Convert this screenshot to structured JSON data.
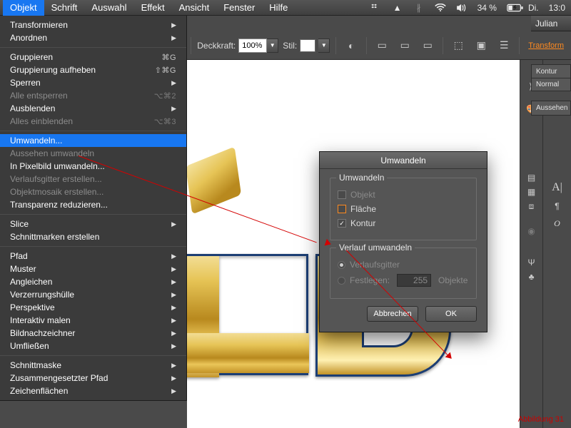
{
  "menubar": {
    "items": [
      "Objekt",
      "Schrift",
      "Auswahl",
      "Effekt",
      "Ansicht",
      "Fenster",
      "Hilfe"
    ],
    "active": 0
  },
  "status": {
    "battery": "34 %",
    "charging_icon": "⚡",
    "day": "Di.",
    "time": "13:0"
  },
  "title_right": "Julian",
  "optionsbar": {
    "opacity_label": "Deckkraft:",
    "opacity_value": "100%",
    "style_label": "Stil:",
    "transform_link": "Transform"
  },
  "dropdown": {
    "groups": [
      [
        {
          "label": "Transformieren",
          "enabled": true,
          "sub": true
        },
        {
          "label": "Anordnen",
          "enabled": true,
          "sub": true
        }
      ],
      [
        {
          "label": "Gruppieren",
          "enabled": true,
          "short": "⌘G"
        },
        {
          "label": "Gruppierung aufheben",
          "enabled": true,
          "short": "⇧⌘G"
        },
        {
          "label": "Sperren",
          "enabled": true,
          "sub": true
        },
        {
          "label": "Alle entsperren",
          "enabled": false,
          "short": "⌥⌘2"
        },
        {
          "label": "Ausblenden",
          "enabled": true,
          "sub": true
        },
        {
          "label": "Alles einblenden",
          "enabled": false,
          "short": "⌥⌘3"
        }
      ],
      [
        {
          "label": "Umwandeln...",
          "enabled": true,
          "selected": true
        },
        {
          "label": "Aussehen umwandeln",
          "enabled": false
        },
        {
          "label": "In Pixelbild umwandeln...",
          "enabled": true
        },
        {
          "label": "Verlaufsgitter erstellen...",
          "enabled": false
        },
        {
          "label": "Objektmosaik erstellen...",
          "enabled": false
        },
        {
          "label": "Transparenz reduzieren...",
          "enabled": true
        }
      ],
      [
        {
          "label": "Slice",
          "enabled": true,
          "sub": true
        },
        {
          "label": "Schnittmarken erstellen",
          "enabled": true
        }
      ],
      [
        {
          "label": "Pfad",
          "enabled": true,
          "sub": true
        },
        {
          "label": "Muster",
          "enabled": true,
          "sub": true
        },
        {
          "label": "Angleichen",
          "enabled": true,
          "sub": true
        },
        {
          "label": "Verzerrungshülle",
          "enabled": true,
          "sub": true
        },
        {
          "label": "Perspektive",
          "enabled": true,
          "sub": true
        },
        {
          "label": "Interaktiv malen",
          "enabled": true,
          "sub": true
        },
        {
          "label": "Bildnachzeichner",
          "enabled": true,
          "sub": true
        },
        {
          "label": "Umfließen",
          "enabled": true,
          "sub": true
        }
      ],
      [
        {
          "label": "Schnittmaske",
          "enabled": true,
          "sub": true
        },
        {
          "label": "Zusammengesetzter Pfad",
          "enabled": true,
          "sub": true
        },
        {
          "label": "Zeichenflächen",
          "enabled": true,
          "sub": true
        }
      ]
    ]
  },
  "right_panel": {
    "tab_kontur": "Kontur",
    "tab_normal": "Normal",
    "tab_aussehen": "Aussehen"
  },
  "dialog": {
    "title": "Umwandeln",
    "section1": {
      "legend": "Umwandeln",
      "objekt": "Objekt",
      "flaeche": "Fläche",
      "kontur": "Kontur"
    },
    "section2": {
      "legend": "Verlauf umwandeln",
      "verlaufsgitter": "Verlaufsgitter",
      "festlegen": "Festlegen:",
      "festlegen_value": "255",
      "festlegen_unit": "Objekte"
    },
    "buttons": {
      "cancel": "Abbrechen",
      "ok": "OK"
    }
  },
  "caption": "Abbildung 31"
}
